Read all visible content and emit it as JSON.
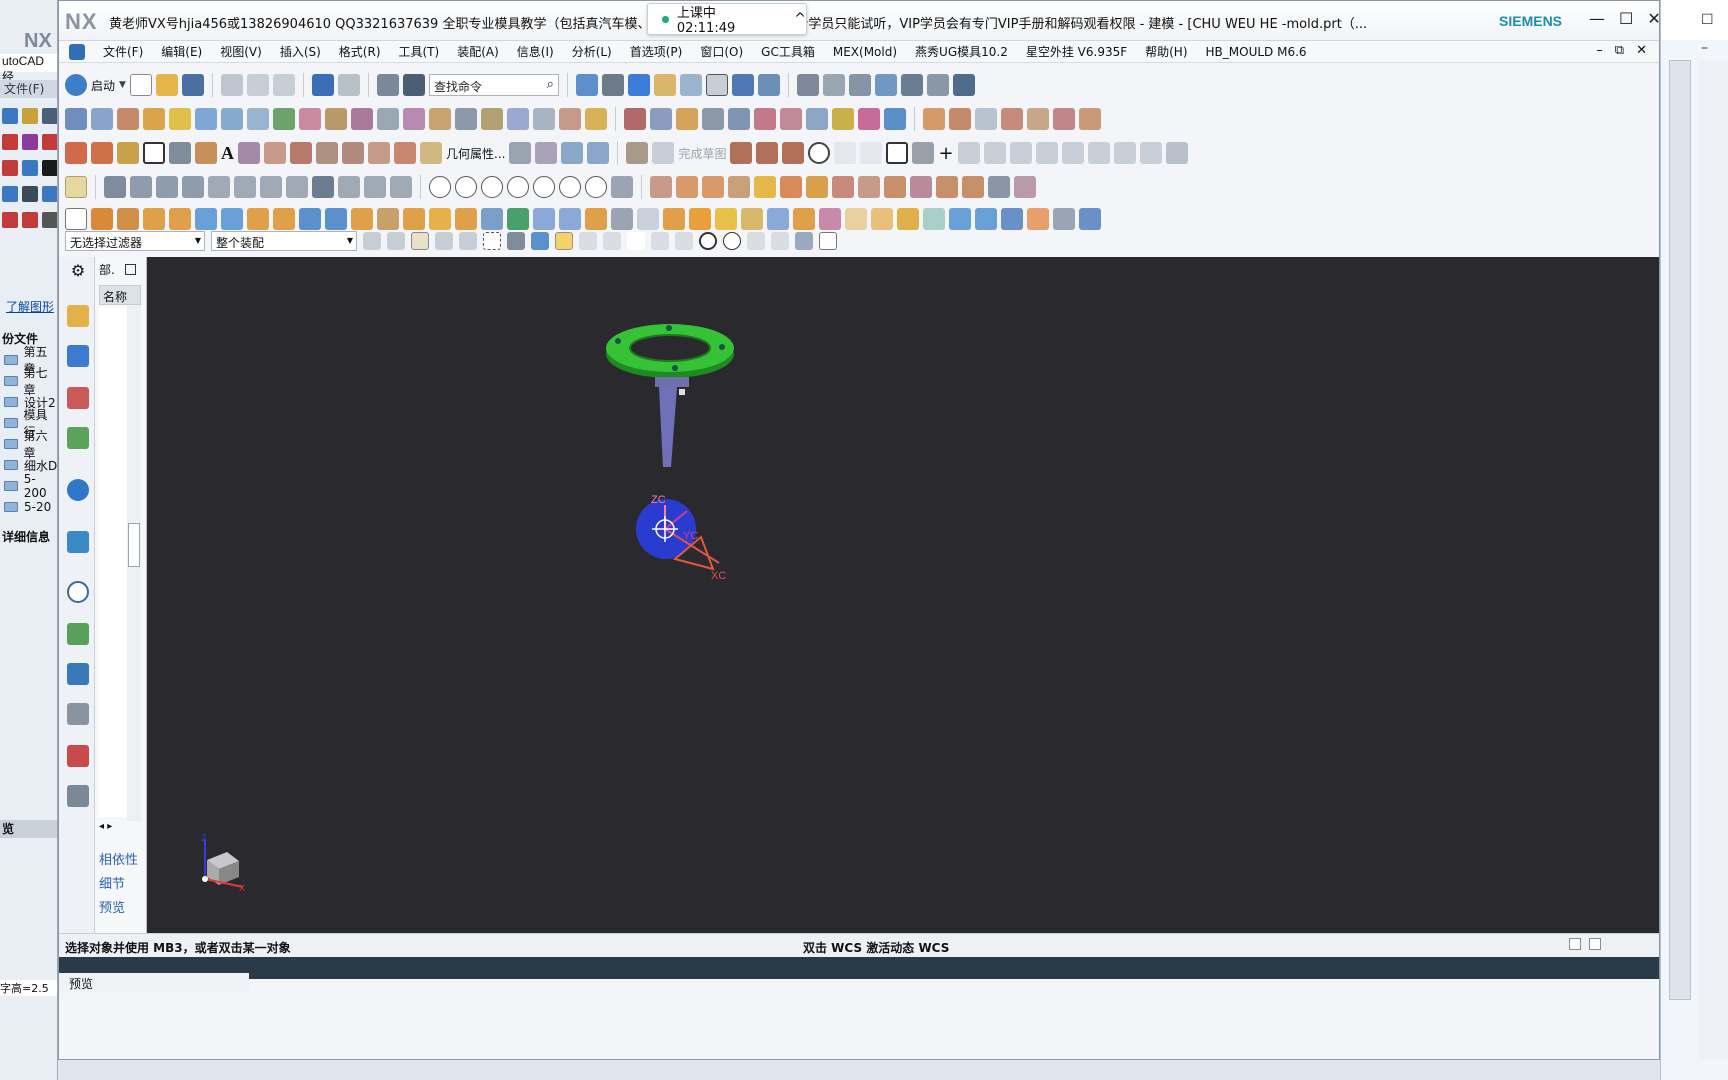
{
  "window": {
    "logo": "NX",
    "title": "黄老师VX号hjia456或13826904610 QQ3321637639 全职专业模具教学（包括真汽车模、双色模流分析及CNC编程新学员只能试听，VIP学员会有专门VIP手册和解码观看权限 - 建模 - [CHU WEU HE -mold.prt（...",
    "brand": "SIEMENS",
    "controls": [
      "—",
      "☐",
      "✕"
    ]
  },
  "recording": {
    "label": "上课中 02:11:49",
    "chevron": "^"
  },
  "menubar": {
    "items": [
      "文件(F)",
      "编辑(E)",
      "视图(V)",
      "插入(S)",
      "格式(R)",
      "工具(T)",
      "装配(A)",
      "信息(I)",
      "分析(L)",
      "首选项(P)",
      "窗口(O)",
      "GC工具箱",
      "MEX(Mold)",
      "燕秀UG模具10.2",
      "星空外挂 V6.935F",
      "帮助(H)",
      "HB_MOULD M6.6"
    ],
    "mdi_controls": [
      "–",
      "⧉",
      "✕"
    ]
  },
  "toolbar": {
    "start_label": "启动",
    "search_placeholder": "查找命令",
    "geom_props_label": "几何属性...",
    "finish_sketch_label": "完成草图"
  },
  "filters": {
    "selection_filter": "无选择过滤器",
    "scope": "整个装配"
  },
  "navigator": {
    "header": "部.",
    "column_name": "名称",
    "links": [
      "相依性",
      "细节",
      "预览"
    ]
  },
  "viewport": {
    "axis_labels": {
      "zc": "ZC",
      "yc": "YC",
      "xc": "XC",
      "triad_z": "Z",
      "triad_x": "X"
    }
  },
  "statusbar": {
    "left": "选择对象并使用 MB3，或者双击某一对象",
    "center": "双击 WCS 激活动态 WCS"
  },
  "background_left": {
    "nx": "NX",
    "app": "utoCAD 经",
    "file_menu": "文件(F)",
    "learn_link": "了解图形",
    "section": "份文件",
    "folders": [
      "第五章",
      "第七章",
      "设计2",
      "模具行",
      "第六章",
      "细水D",
      "5-200",
      "5-20"
    ],
    "details": "详细信息",
    "preview": "览",
    "bottom_text": "字高=2.5"
  },
  "bottom": {
    "preview": "预览"
  }
}
